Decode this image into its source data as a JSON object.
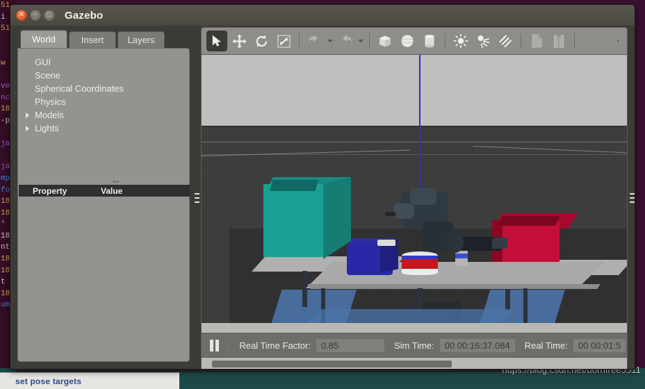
{
  "window": {
    "title": "Gazebo",
    "controls": [
      {
        "name": "close",
        "glyph": "✕",
        "color": "#d44414"
      },
      {
        "name": "minimize",
        "glyph": "−",
        "color": "#6f6a63"
      },
      {
        "name": "maximize",
        "glyph": "□",
        "color": "#6f6a63"
      }
    ]
  },
  "left_panel": {
    "tabs": [
      {
        "label": "World",
        "active": true
      },
      {
        "label": "Insert",
        "active": false
      },
      {
        "label": "Layers",
        "active": false
      }
    ],
    "tree": [
      {
        "label": "GUI",
        "expandable": false
      },
      {
        "label": "Scene",
        "expandable": false
      },
      {
        "label": "Spherical Coordinates",
        "expandable": false
      },
      {
        "label": "Physics",
        "expandable": false
      },
      {
        "label": "Models",
        "expandable": true
      },
      {
        "label": "Lights",
        "expandable": true
      }
    ],
    "property_table": {
      "columns": [
        "Property",
        "Value"
      ],
      "rows": [],
      "handle_glyph": "\"\""
    }
  },
  "toolbar": {
    "buttons": [
      {
        "name": "select-mode",
        "icon": "cursor-arrow-icon",
        "selected": true
      },
      {
        "name": "translate-mode",
        "icon": "move-arrows-icon",
        "selected": false
      },
      {
        "name": "rotate-mode",
        "icon": "rotate-icon",
        "selected": false
      },
      {
        "name": "scale-mode",
        "icon": "scale-icon",
        "selected": false
      },
      {
        "name": "undo",
        "icon": "undo-arrow-icon",
        "selected": false
      },
      {
        "name": "undo-history",
        "icon": "chevron-down-icon",
        "selected": false
      },
      {
        "name": "redo",
        "icon": "redo-arrow-icon",
        "selected": false
      },
      {
        "name": "redo-history",
        "icon": "chevron-down-icon",
        "selected": false
      },
      {
        "name": "insert-box",
        "icon": "cube-icon",
        "selected": false
      },
      {
        "name": "insert-sphere",
        "icon": "sphere-icon",
        "selected": false
      },
      {
        "name": "insert-cylinder",
        "icon": "cylinder-icon",
        "selected": false
      },
      {
        "name": "insert-point-light",
        "icon": "point-light-icon",
        "selected": false
      },
      {
        "name": "insert-spot-light",
        "icon": "spot-light-icon",
        "selected": false
      },
      {
        "name": "insert-directional-light",
        "icon": "directional-light-icon",
        "selected": false
      },
      {
        "name": "copy",
        "icon": "copy-icon",
        "selected": false
      },
      {
        "name": "paste",
        "icon": "paste-icon",
        "selected": false
      }
    ],
    "overflow_glyph": "·"
  },
  "status_bar": {
    "pause_icon": "pause-icon",
    "real_time_factor_label": "Real Time Factor:",
    "real_time_factor_value": "0.85",
    "sim_time_label": "Sim Time:",
    "sim_time_value": "00 00:16:37.084",
    "real_time_label": "Real Time:",
    "real_time_value": "00 00:01:5"
  },
  "viewport": {
    "scene_objects": [
      {
        "name": "teal-bin",
        "color": "#1f9c90"
      },
      {
        "name": "red-bin",
        "color": "#c40f38"
      },
      {
        "name": "blue-object",
        "color": "#2b2ba8"
      },
      {
        "name": "red-white-can",
        "color": "#c5171e"
      },
      {
        "name": "robot-arm",
        "color": "#2b3138"
      },
      {
        "name": "table",
        "color": "#9d9d9d"
      },
      {
        "name": "floor-mat",
        "color": "#4b74a8"
      }
    ],
    "axis_colors": {
      "z": "#2a2ae0",
      "y": "#1ea81e",
      "grid": "#9d9d9d"
    }
  },
  "desktop": {
    "watermark": "https://blog.csdn.net/bornfree5511",
    "taskbar_label": "set pose targets",
    "terminal_lines": [
      "51",
      "i",
      "51",
      "",
      "",
      "w",
      "",
      "ve",
      "nc",
      "18",
      "-p",
      "",
      "ja",
      "",
      "ja",
      "mp",
      "fo",
      "18",
      "18",
      "'",
      "18",
      "nt",
      "18",
      "18",
      "t",
      "18",
      "um"
    ]
  }
}
